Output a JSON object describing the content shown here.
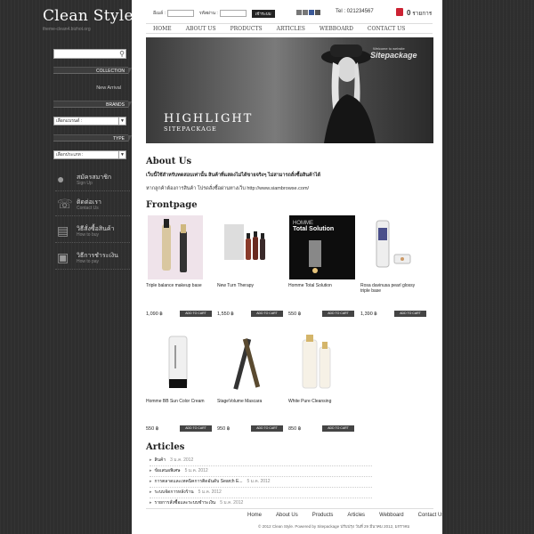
{
  "brand": {
    "title": "Clean Style",
    "subtitle": "theme-clean4.bizhot.org"
  },
  "sidebar": {
    "collection_label": "COLLECTION",
    "new_arrival": "New Arrival",
    "brands_label": "BRANDS",
    "brand_select": "เลือกแบรนด์ :",
    "type_label": "TYPE",
    "type_select": "เลือกประเภท :",
    "nav": [
      {
        "th": "สมัครสมาชิก",
        "en": "Sign Up",
        "icon": "person-icon"
      },
      {
        "th": "ติดต่อเรา",
        "en": "Contact Us",
        "icon": "phone-icon"
      },
      {
        "th": "วิธีสั่งซื้อสินค้า",
        "en": "How to buy",
        "icon": "cart-icon"
      },
      {
        "th": "วิธีการชำระเงิน",
        "en": "How to pay",
        "icon": "payment-icon"
      }
    ]
  },
  "topbar": {
    "username_label": "อีเมล์ :",
    "password_label": "รหัสผ่าน :",
    "login_button": "เข้าระบบ",
    "tel": "Tel : 021234567",
    "cart_count": "0",
    "cart_label": "รายการ"
  },
  "nav": [
    "HOME",
    "ABOUT US",
    "PRODUCTS",
    "ARTICLES",
    "WEBBOARD",
    "CONTACT US"
  ],
  "hero": {
    "title": "HIGHLIGHT",
    "subtitle": "SITEPACKAGE",
    "watermark_small": "Welcome to website",
    "watermark": "Sitepackage"
  },
  "about": {
    "title": "About Us",
    "bold_text": "เว็บนี้ใช้สำหรับทดสอบเท่านั้น สินค้าที่แสดงไม่ได้ขายจริงๆ ไม่สามารถสั่งซื้อสินค้าได้",
    "text": "หากลูกค้าต้องการสินค้า โปรดสั่งซื้อผ่านทางเว็บ http://www.siambrowse.com/"
  },
  "frontpage": {
    "title": "Frontpage",
    "add_to_cart": "ADD TO CART",
    "products": [
      {
        "name": "Triple balance makeup base",
        "price": "1,090 ฿"
      },
      {
        "name": "New Turn Therapy",
        "price": "1,550 ฿"
      },
      {
        "name": "Homme Total Solution",
        "price": "550 ฿"
      },
      {
        "name": "Rosa davinusa pearl glossy triple base",
        "price": "1,390 ฿"
      },
      {
        "name": "Homme BB Sun Color Cream",
        "price": "550 ฿"
      },
      {
        "name": "StageVolume Mascara",
        "price": "950 ฿"
      },
      {
        "name": "White Pure Cleansing",
        "price": "850 ฿"
      }
    ]
  },
  "articles": {
    "title": "Articles",
    "items": [
      {
        "title": "สินค้า",
        "date": "3 ม.ค. 2012"
      },
      {
        "title": "ข้อเสนอพิเศษ",
        "date": "5 ม.ค. 2012"
      },
      {
        "title": "การตลาดและเทคนิคการติดอันดับ Search E...",
        "date": "5 ม.ค. 2012"
      },
      {
        "title": "ระบบจัดการหลังร้าน",
        "date": "5 ม.ค. 2012"
      },
      {
        "title": "รายการสั่งซื้อและระบบชำระเงิน",
        "date": "5 ม.ค. 2012"
      }
    ]
  },
  "footer": {
    "links": [
      "Home",
      "About Us",
      "Products",
      "Articles",
      "Webboard",
      "Contact Us"
    ],
    "copyright": "© 2012 Clean Style. Powered by Sitepackage ปรับปรุง วันที่ 29 มีนาคม 2012, มกราคม"
  }
}
